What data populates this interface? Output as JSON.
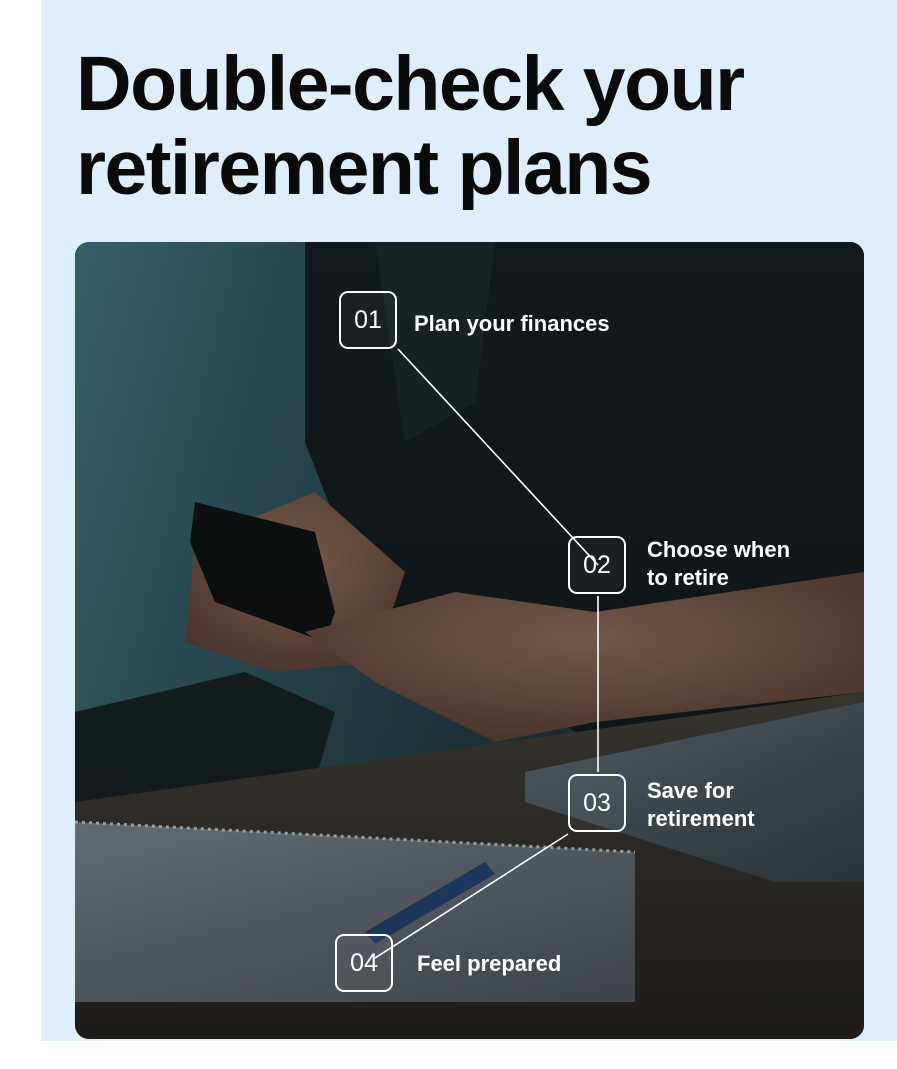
{
  "headline": {
    "line1": "Double-check your",
    "line2": "retirement plans"
  },
  "steps": [
    {
      "number": "01",
      "label": "Plan your finances"
    },
    {
      "number": "02",
      "label": "Choose when\nto retire"
    },
    {
      "number": "03",
      "label": "Save for\nretirement"
    },
    {
      "number": "04",
      "label": "Feel prepared"
    }
  ],
  "colors": {
    "background": "#dfeefc",
    "headline": "#0b0b0b",
    "step_text": "#ffffff"
  }
}
